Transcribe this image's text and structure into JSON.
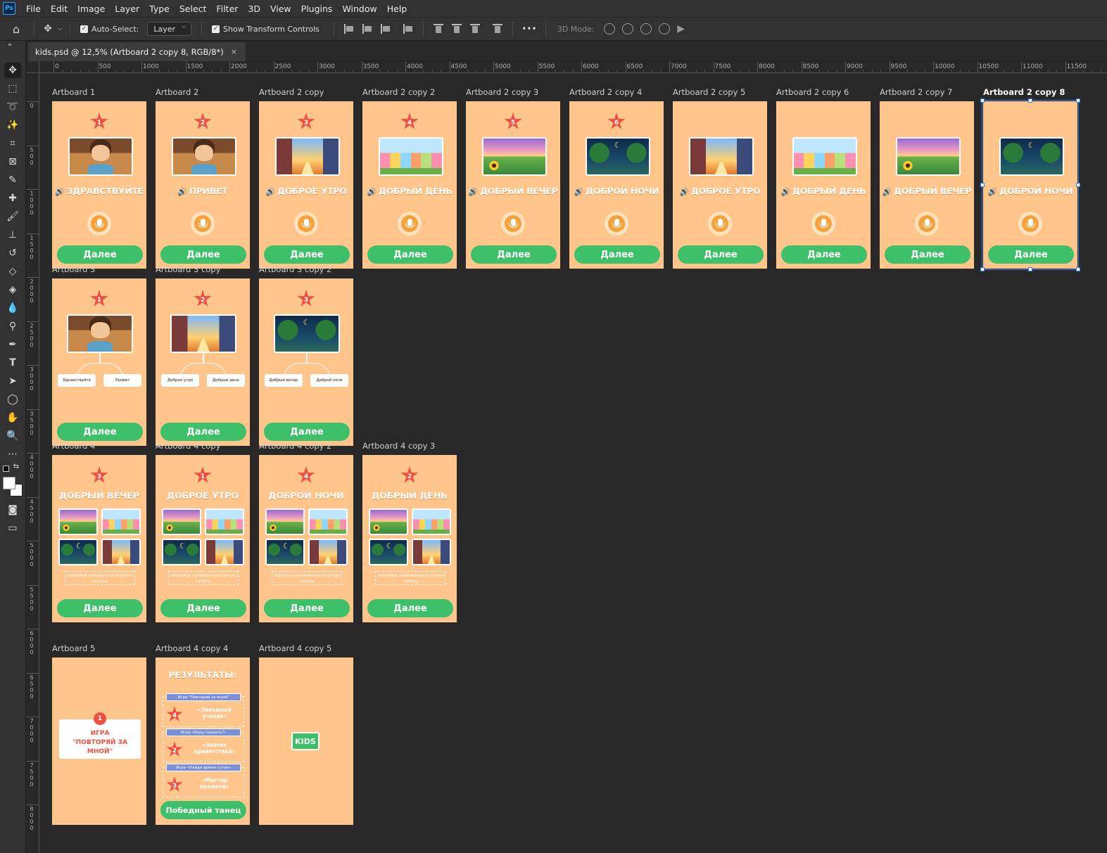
{
  "app": {
    "logo": "Ps",
    "menu": [
      "File",
      "Edit",
      "Image",
      "Layer",
      "Type",
      "Select",
      "Filter",
      "3D",
      "View",
      "Plugins",
      "Window",
      "Help"
    ]
  },
  "options": {
    "auto_select_label": "Auto-Select:",
    "auto_select_target": "Layer",
    "show_transform_label": "Show Transform Controls",
    "mode_3d_label": "3D Mode:",
    "more": "•••"
  },
  "tab": {
    "title": "kids.psd @ 12,5% (Artboard 2 copy 8, RGB/8*)",
    "close": "×"
  },
  "ruler": {
    "top_labels": [
      "0",
      "500",
      "1000",
      "1500",
      "2000",
      "2500",
      "3000",
      "3500",
      "4000",
      "4500",
      "5000",
      "5500",
      "6000",
      "6500",
      "7000",
      "7500",
      "8000",
      "8500",
      "9000",
      "9500",
      "10000",
      "10500",
      "11000",
      "11500"
    ],
    "left_labels": [
      "0",
      "500",
      "1000",
      "1500",
      "2000",
      "2500",
      "3000",
      "3500",
      "4000",
      "4500",
      "5000",
      "5500",
      "6000",
      "6500",
      "7000",
      "7500",
      "8000"
    ]
  },
  "common": {
    "next": "Далее",
    "hint": "Yuqoridagi variantlardan to'g'risini tanlang"
  },
  "row1": [
    {
      "title": "Artboard 1",
      "star": "1",
      "pic": "kid",
      "greet": "ЗДРАВСТВУЙТЕ"
    },
    {
      "title": "Artboard 2",
      "star": "2",
      "pic": "kid",
      "greet": "ПРИВЕТ"
    },
    {
      "title": "Artboard 2 copy",
      "star": "3",
      "pic": "city",
      "greet": "ДОБРОЕ УТРО"
    },
    {
      "title": "Artboard 2 copy 2",
      "star": "4",
      "pic": "town",
      "greet": "ДОБРЫЙ ДЕНЬ"
    },
    {
      "title": "Artboard 2 copy 3",
      "star": "5",
      "pic": "eve",
      "greet": "ДОБРЫЙ ВЕЧЕР"
    },
    {
      "title": "Artboard 2 copy 4",
      "star": "6",
      "pic": "night",
      "greet": "ДОБРОЙ НОЧИ"
    },
    {
      "title": "Artboard 2 copy 5",
      "star": "",
      "pic": "city",
      "greet": "ДОБРОЕ УТРО"
    },
    {
      "title": "Artboard 2 copy 6",
      "star": "",
      "pic": "town",
      "greet": "ДОБРЫЙ ДЕНЬ"
    },
    {
      "title": "Artboard 2 copy 7",
      "star": "",
      "pic": "eve",
      "greet": "ДОБРЫЙ ВЕЧЕР"
    },
    {
      "title": "Artboard 2 copy 8",
      "star": "",
      "pic": "night",
      "greet": "ДОБРОЙ НОЧИ",
      "selected": true
    }
  ],
  "row2": [
    {
      "title": "Artboard 3",
      "star": "1",
      "pic": "kid",
      "options": [
        "Здравствуйте",
        "Привет"
      ]
    },
    {
      "title": "Artboard 3 copy",
      "star": "2",
      "pic": "city",
      "options": [
        "Доброе утро",
        "Добрый день"
      ]
    },
    {
      "title": "Artboard 3 copy 2",
      "star": "3",
      "pic": "night",
      "options": [
        "Добрый вечер",
        "Доброй ночи"
      ]
    }
  ],
  "row3": [
    {
      "title": "Artboard 4",
      "star": "3",
      "heading": "ДОБРЫЙ ВЕЧЕР"
    },
    {
      "title": "Artboard 4 copy",
      "star": "1",
      "heading": "ДОБРОЕ УТРО"
    },
    {
      "title": "Artboard 4 copy 2",
      "star": "4",
      "heading": "ДОБРОЙ НОЧИ"
    },
    {
      "title": "Artboard 4 copy 3",
      "star": "2",
      "heading": "ДОБРЫЙ ДЕНЬ"
    }
  ],
  "row4": {
    "ab5": {
      "title": "Artboard 5",
      "num": "1",
      "game_line1": "ИГРА",
      "game_line2": "\"ПОВТОРЯЙ ЗА МНОЙ\""
    },
    "ab6": {
      "title": "Artboard 4 copy 4",
      "heading": "РЕЗУЛЬТАТЫ:",
      "results": [
        {
          "tag": "Игра \"Повторяй за мной\"",
          "star": "4",
          "award": "«Звездный ученик»"
        },
        {
          "tag": "Игра «Кому сказать?»",
          "star": "2",
          "award": "«Знаток приветствий»"
        },
        {
          "tag": "Игра «Найди время суток»",
          "star": "3",
          "award": "«Мастер времени»"
        }
      ],
      "button": "Победный танец"
    },
    "ab7": {
      "title": "Artboard 4 copy 5",
      "badge": "KIDS"
    }
  }
}
